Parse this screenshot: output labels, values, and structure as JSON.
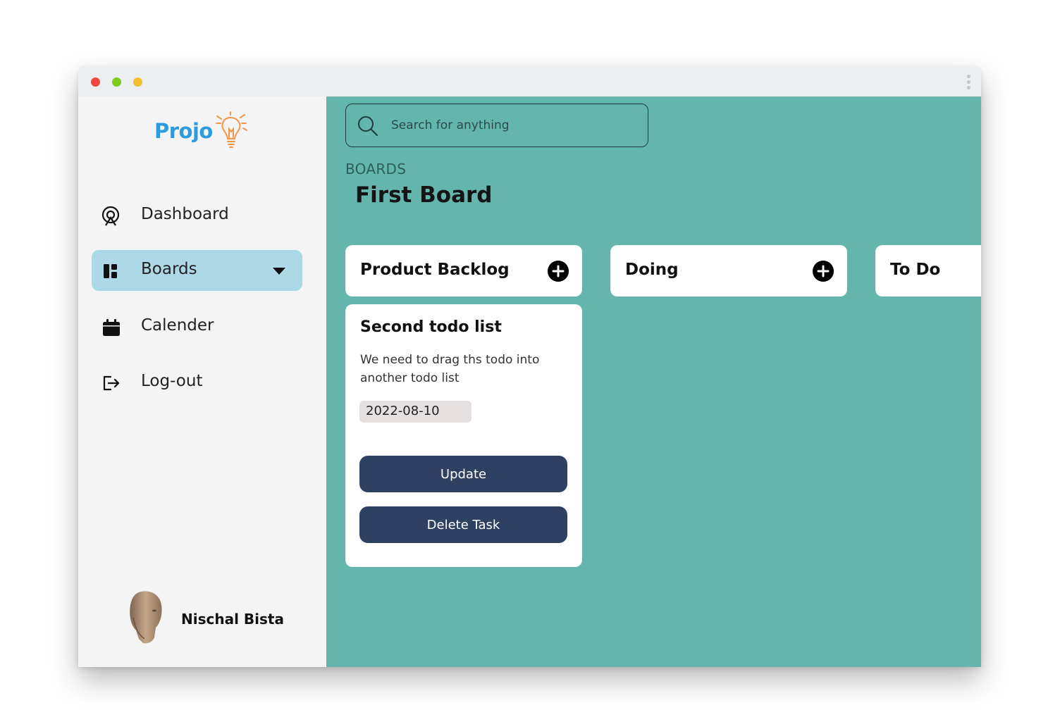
{
  "app": {
    "logo_text": "Projo"
  },
  "sidebar": {
    "items": [
      {
        "label": "Dashboard",
        "icon": "dashboard-icon"
      },
      {
        "label": "Boards",
        "icon": "boards-icon",
        "active": true
      },
      {
        "label": "Calender",
        "icon": "calendar-icon"
      },
      {
        "label": "Log-out",
        "icon": "logout-icon"
      }
    ],
    "user": {
      "name": "Nischal Bista"
    }
  },
  "main": {
    "search": {
      "placeholder": "Search for anything"
    },
    "breadcrumb": "BOARDS",
    "board_title": "First Board",
    "columns": [
      {
        "title": "Product Backlog"
      },
      {
        "title": "Doing"
      },
      {
        "title": "To Do"
      }
    ],
    "cards": [
      {
        "title": "Second todo list",
        "description": "We need to drag ths todo into another todo list",
        "date": "2022-08-10",
        "update_label": "Update",
        "delete_label": "Delete Task"
      }
    ]
  },
  "colors": {
    "accent_main": "#64b6ad",
    "sidebar_active": "#add8e6",
    "button": "#2f4163",
    "logo": "#2d9be0",
    "logo_bulb": "#f5954a"
  }
}
